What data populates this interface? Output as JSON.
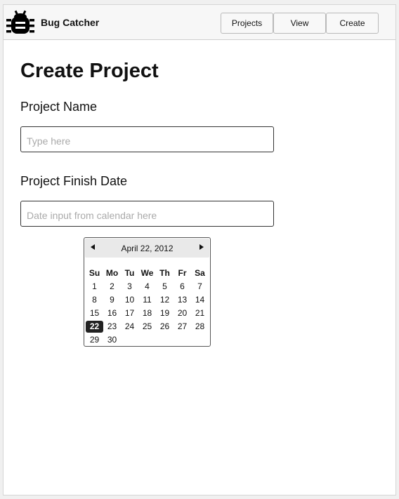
{
  "header": {
    "brand": "Bug Catcher",
    "logo_icon": "bug-icon",
    "nav": {
      "projects": "Projects",
      "view": "View",
      "create": "Create"
    }
  },
  "main": {
    "title": "Create Project",
    "project_name": {
      "label": "Project Name",
      "placeholder": "Type here",
      "value": ""
    },
    "finish_date": {
      "label": "Project Finish Date",
      "placeholder": "Date input from calendar here",
      "value": ""
    }
  },
  "calendar": {
    "title": "April 22, 2012",
    "prev_icon": "triangle-left-icon",
    "next_icon": "triangle-right-icon",
    "weekdays": [
      "Su",
      "Mo",
      "Tu",
      "We",
      "Th",
      "Fr",
      "Sa"
    ],
    "weeks": [
      [
        "1",
        "2",
        "3",
        "4",
        "5",
        "6",
        "7"
      ],
      [
        "8",
        "9",
        "10",
        "11",
        "12",
        "13",
        "14"
      ],
      [
        "15",
        "16",
        "17",
        "18",
        "19",
        "20",
        "21"
      ],
      [
        "22",
        "23",
        "24",
        "25",
        "26",
        "27",
        "28"
      ],
      [
        "29",
        "30",
        "",
        "",
        "",
        "",
        ""
      ]
    ],
    "selected": "22"
  }
}
